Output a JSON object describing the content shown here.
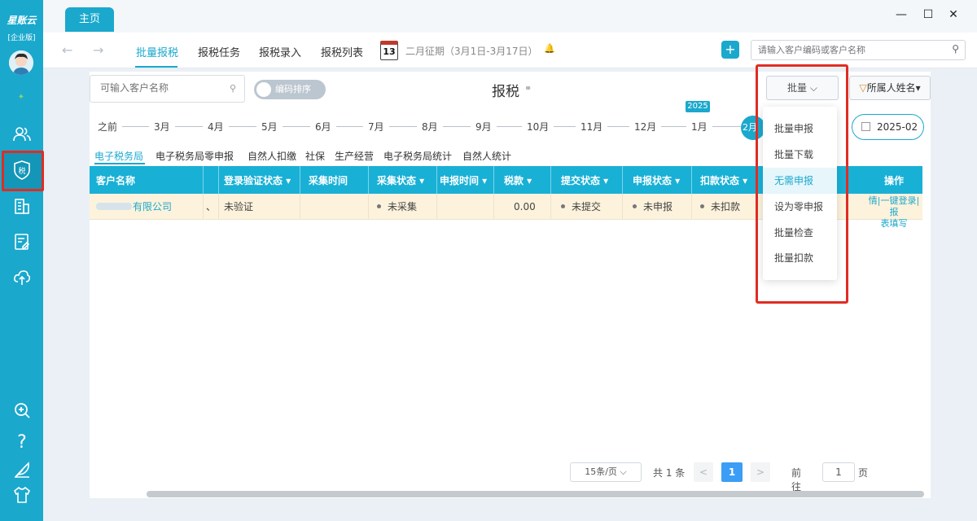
{
  "app": {
    "brand": "星账云",
    "edition": "[企业版]",
    "home_tab": "主页",
    "window_controls": {
      "minimize": "—",
      "maximize": "☐",
      "close": "✕"
    }
  },
  "sidebar": {
    "items": [
      {
        "icon": "users-icon"
      },
      {
        "icon": "tax-shield-icon",
        "active": true,
        "glyph": "税"
      },
      {
        "icon": "building-icon"
      },
      {
        "icon": "document-edit-icon"
      },
      {
        "icon": "cloud-upload-icon"
      },
      {
        "icon": "zoom-in-icon"
      },
      {
        "icon": "help-icon",
        "glyph": "?"
      },
      {
        "icon": "feather-icon"
      },
      {
        "icon": "shirt-icon"
      }
    ]
  },
  "nav": {
    "back": "←",
    "forward": "→",
    "items": [
      "批量报税",
      "报税任务",
      "报税录入",
      "报税列表"
    ],
    "calendar_day": "13",
    "period": "二月征期（3月1日-3月17日）",
    "bell": "🔔",
    "plus": "+",
    "search_placeholder": "请输入客户编码或客户名称"
  },
  "toolbar": {
    "customer_placeholder": "可输入客户名称",
    "sort_toggle": "编码排序",
    "title": "报税",
    "batch_button": "批量 ⌵",
    "owner_filter": "所属人姓名▾",
    "year_badge": "2025",
    "month_picker": "2025-02"
  },
  "timeline": {
    "items": [
      "之前",
      "3月",
      "4月",
      "5月",
      "6月",
      "7月",
      "8月",
      "9月",
      "10月",
      "11月",
      "12月",
      "1月"
    ],
    "current": "2月"
  },
  "subtabs": [
    "电子税务局",
    "电子税务局零申报",
    "自然人扣缴",
    "社保",
    "生产经营",
    "电子税务局统计",
    "自然人统计"
  ],
  "table": {
    "headers": [
      "客户名称",
      "登录验证状态 ▾",
      "采集时间",
      "采集状态 ▾",
      "申报时间 ▾",
      "税款 ▾",
      "提交状态 ▾",
      "申报状态 ▾",
      "扣款状态 ▾",
      "操作"
    ],
    "row": {
      "customer_suffix": "有限公司",
      "marker": "、",
      "login_status": "未验证",
      "collect_time": "",
      "collect_status": "未采集",
      "declare_time": "",
      "tax": "0.00",
      "submit_status": "未提交",
      "declare_status": "未申报",
      "deduct_status": "未扣款",
      "ops_line1": "情|一键登录|报",
      "ops_line2": "表填写"
    }
  },
  "pager": {
    "page_size": "15条/页 ⌵",
    "total": "共 1 条",
    "prev": "<",
    "current_page": "1",
    "next": ">",
    "goto_label": "前往",
    "goto_value": "1",
    "page_label": "页"
  },
  "batch_menu": {
    "items": [
      "批量申报",
      "批量下载",
      "无需申报",
      "设为零申报",
      "批量检查",
      "批量扣款"
    ],
    "hovered": "无需申报"
  },
  "colors": {
    "accent": "#1ba8cd",
    "highlight_frame": "#e02c23",
    "row_highlight": "#fdf2dc"
  }
}
